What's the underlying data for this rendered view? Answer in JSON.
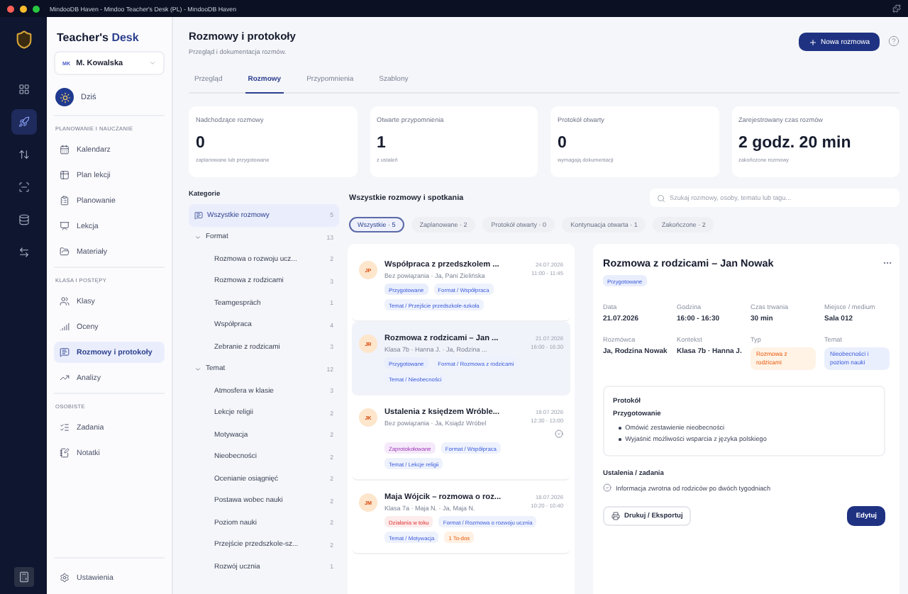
{
  "window": {
    "title": "MindooDB Haven - Mindoo Teacher's Desk (PL) - MindooDB Haven"
  },
  "rail": [
    {
      "kind": "grid",
      "selected": false
    },
    {
      "kind": "rocket",
      "selected": true
    },
    {
      "kind": "sort",
      "selected": false
    },
    {
      "kind": "scan",
      "selected": false
    },
    {
      "kind": "database",
      "selected": false
    },
    {
      "kind": "swap",
      "selected": false
    }
  ],
  "sidebar": {
    "brand": "Teacher's",
    "brand_accent": "Desk",
    "user": {
      "initials": "MK",
      "name": "M. Kowalska"
    },
    "today": "Dziś",
    "sections": [
      {
        "heading": "PLANOWANIE I NAUCZANIE",
        "items": [
          {
            "label": "Kalendarz",
            "kind": "calendar",
            "selected": false
          },
          {
            "label": "Plan lekcji",
            "kind": "timetable",
            "selected": false
          },
          {
            "label": "Planowanie",
            "kind": "planning",
            "selected": false
          },
          {
            "label": "Lekcja",
            "kind": "lesson",
            "selected": false
          },
          {
            "label": "Materiały",
            "kind": "folder",
            "selected": false
          }
        ]
      },
      {
        "heading": "KLASA I POSTĘPY",
        "items": [
          {
            "label": "Klasy",
            "kind": "class",
            "selected": false
          },
          {
            "label": "Oceny",
            "kind": "grades",
            "selected": false
          },
          {
            "label": "Rozmowy i protokoły",
            "kind": "chat",
            "selected": true
          },
          {
            "label": "Analizy",
            "kind": "chart",
            "selected": false
          }
        ]
      },
      {
        "heading": "OSOBISTE",
        "items": [
          {
            "label": "Zadania",
            "kind": "tasks",
            "selected": false
          },
          {
            "label": "Notatki",
            "kind": "notes",
            "selected": false
          }
        ]
      }
    ],
    "settings": "Ustawienia"
  },
  "page": {
    "title": "Rozmowy i protokoły",
    "subtitle": "Przegląd i dokumentacja rozmów.",
    "new_button": "Nowa rozmowa"
  },
  "tabs": [
    {
      "label": "Przegląd",
      "selected": false
    },
    {
      "label": "Rozmowy",
      "selected": true
    },
    {
      "label": "Przypomnienia",
      "selected": false
    },
    {
      "label": "Szablony",
      "selected": false
    }
  ],
  "stats": [
    {
      "label": "Nadchodzące rozmowy",
      "value": "0",
      "note": "zaplanowane lub przygotowane"
    },
    {
      "label": "Otwarte przypomnienia",
      "value": "1",
      "note": "z ustaleń"
    },
    {
      "label": "Protokół otwarty",
      "value": "0",
      "note": "wymagają dokumentacji"
    },
    {
      "label": "Zarejestrowany czas rozmów",
      "value": "2 godz. 20 min",
      "note": "zakończone rozmowy"
    }
  ],
  "categories": {
    "heading": "Kategorie",
    "items": [
      {
        "label": "Wszystkie rozmowy",
        "count": "5",
        "selected": true
      },
      {
        "label": "Format",
        "count": "13",
        "selected": false,
        "expanded": true,
        "children": [
          {
            "label": "Rozmowa o rozwoju ucz...",
            "count": "2",
            "selected": false
          },
          {
            "label": "Rozmowa z rodzicami",
            "count": "3",
            "selected": false
          },
          {
            "label": "Teamgespräch",
            "count": "1",
            "selected": false
          },
          {
            "label": "Współpraca",
            "count": "4",
            "selected": false
          },
          {
            "label": "Zebranie z rodzicami",
            "count": "3",
            "selected": false
          }
        ]
      },
      {
        "label": "Temat",
        "count": "12",
        "selected": false,
        "expanded": true,
        "children": [
          {
            "label": "Atmosfera w klasie",
            "count": "3",
            "selected": false
          },
          {
            "label": "Lekcje religii",
            "count": "2",
            "selected": false
          },
          {
            "label": "Motywacja",
            "count": "2",
            "selected": false
          },
          {
            "label": "Nieobecności",
            "count": "2",
            "selected": false
          },
          {
            "label": "Ocenianie osiągnięć",
            "count": "2",
            "selected": false
          },
          {
            "label": "Postawa wobec nauki",
            "count": "2",
            "selected": false
          },
          {
            "label": "Poziom nauki",
            "count": "2",
            "selected": false
          },
          {
            "label": "Przejście przedszkole-sz...",
            "count": "2",
            "selected": false
          },
          {
            "label": "Rozwój ucznia",
            "count": "1",
            "selected": false
          }
        ]
      }
    ]
  },
  "list": {
    "heading": "Wszystkie rozmowy i spotkania",
    "search": {
      "placeholder": "Szukaj rozmowy, osoby, tematu lub tagu..."
    },
    "filters": [
      {
        "label": "Wszystkie · 5",
        "selected": true
      },
      {
        "label": "Zaplanowane · 2",
        "selected": false
      },
      {
        "label": "Protokół otwarty · 0",
        "selected": false
      },
      {
        "label": "Kontynuacja otwarta · 1",
        "selected": false
      },
      {
        "label": "Zakończone · 2",
        "selected": false
      }
    ],
    "items": [
      {
        "initials": "JP",
        "title": "Współpraca z przedszkolem ...",
        "subtitle": "Bez powiązania · Ja, Pani Zielińska",
        "date": "24.07.2026",
        "time": "11:00 - 11:45",
        "selected": false,
        "check": false,
        "tags": [
          {
            "text": "Przygotowane",
            "kind": "prepared"
          },
          {
            "text": "Format / Współpraca",
            "kind": "category"
          },
          {
            "text": "Temat / Przejście przedszkole-szkoła",
            "kind": "category"
          }
        ]
      },
      {
        "initials": "JR",
        "title": "Rozmowa z rodzicami – Jan ...",
        "subtitle": "Klasa 7b · Hanna J. · Ja, Rodzina ...",
        "date": "21.07.2026",
        "time": "16:00 - 16:30",
        "selected": true,
        "check": false,
        "tags": [
          {
            "text": "Przygotowane",
            "kind": "prepared"
          },
          {
            "text": "Format / Rozmowa z rodzicami",
            "kind": "category"
          },
          {
            "text": "Temat / Nieobecności",
            "kind": "category"
          }
        ]
      },
      {
        "initials": "JK",
        "title": "Ustalenia z księdzem Wróble...",
        "subtitle": "Bez powiązania · Ja, Ksiądz Wróbel",
        "date": "19.07.2026",
        "time": "12:30 - 13:00",
        "selected": false,
        "check": true,
        "tags": [
          {
            "text": "Zaprotokołowane",
            "kind": "recorded"
          },
          {
            "text": "Format / Współpraca",
            "kind": "category"
          },
          {
            "text": "Temat / Lekcje religii",
            "kind": "category"
          }
        ]
      },
      {
        "initials": "JM",
        "title": "Maja Wójcik – rozmowa o roz...",
        "subtitle": "Klasa 7a · Maja N. · Ja, Maja N.",
        "date": "18.07.2026",
        "time": "10:20 - 10:40",
        "selected": false,
        "check": false,
        "tags": [
          {
            "text": "Działania w toku",
            "kind": "active"
          },
          {
            "text": "Format / Rozmowa o rozwoju ucznia",
            "kind": "category"
          },
          {
            "text": "Temat / Motywacja",
            "kind": "category"
          },
          {
            "text": "1 To-dos",
            "kind": "todo"
          }
        ]
      }
    ]
  },
  "detail": {
    "title": "Rozmowa z rodzicami – Jan Nowak",
    "status": {
      "text": "Przygotowane",
      "kind": "prepared"
    },
    "fields": [
      {
        "label": "Data",
        "value": "21.07.2026",
        "kind": "text"
      },
      {
        "label": "Godzina",
        "value": "16:00 - 16:30",
        "kind": "text"
      },
      {
        "label": "Czas trwania",
        "value": "30 min",
        "kind": "text"
      },
      {
        "label": "Miejsce / medium",
        "value": "Sala 012",
        "kind": "text"
      },
      {
        "label": "Rozmówca",
        "value": "Ja, Rodzina Nowak",
        "kind": "text"
      },
      {
        "label": "Kontekst",
        "value": "Klasa 7b · Hanna J.",
        "kind": "text"
      },
      {
        "label": "Typ",
        "value": "Rozmowa z rodzicami",
        "kind": "type"
      },
      {
        "label": "Temat",
        "value": "Nieobecności i poziom nauki",
        "kind": "topic"
      }
    ],
    "protocol": {
      "heading": "Protokół",
      "subheading": "Przygotowanie",
      "bullets": [
        "Omówić zestawienie nieobecności",
        "Wyjaśnić możliwości wsparcia z języka polskiego"
      ]
    },
    "tasks_heading": "Ustalenia / zadania",
    "tasks": [
      {
        "text": "Informacja zwrotna od rodziców po dwóch tygodniach",
        "done": false
      }
    ],
    "print_button": "Drukuj / Eksportuj",
    "edit_button": "Edytuj"
  }
}
